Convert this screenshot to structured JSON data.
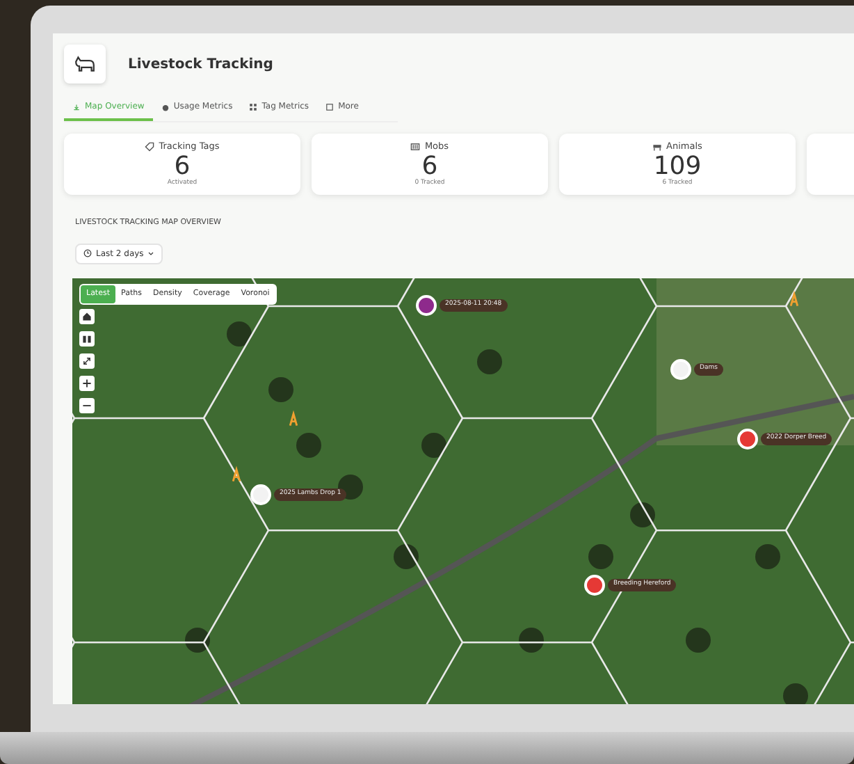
{
  "app": {
    "title": "Livestock Tracking"
  },
  "tabs": [
    {
      "label": "Map Overview",
      "selected": true
    },
    {
      "label": "Usage Metrics",
      "selected": false
    },
    {
      "label": "Tag Metrics",
      "selected": false
    },
    {
      "label": "More",
      "selected": false
    }
  ],
  "stats": [
    {
      "label": "Tracking Tags",
      "value": "6",
      "caption": "Activated"
    },
    {
      "label": "Mobs",
      "value": "6",
      "caption": "0 Tracked"
    },
    {
      "label": "Animals",
      "value": "109",
      "caption": "6 Tracked"
    }
  ],
  "map_section": {
    "title": "LIVESTOCK TRACKING MAP OVERVIEW",
    "range": "Last 2 days"
  },
  "map_modes": [
    {
      "label": "Latest",
      "selected": true
    },
    {
      "label": "Paths",
      "selected": false
    },
    {
      "label": "Density",
      "selected": false
    },
    {
      "label": "Coverage",
      "selected": false
    },
    {
      "label": "Voronoi",
      "selected": false
    }
  ],
  "markers": [
    {
      "label": "2025-08-11 20:48",
      "color": "#8e2a8c"
    },
    {
      "label": "Dams",
      "color": "#f2f2f2"
    },
    {
      "label": "2022 Dorper Breed",
      "color": "#e53935"
    },
    {
      "label": "2025 Lambs Drop 1",
      "color": "#f2f2f2"
    },
    {
      "label": "Breeding Hereford",
      "color": "#e53935"
    }
  ]
}
